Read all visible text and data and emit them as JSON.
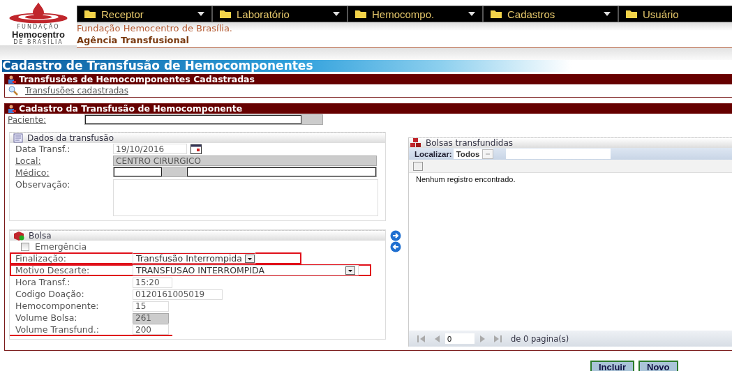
{
  "logo": {
    "top": "FUNDAÇÃO",
    "name": "Hemocentro",
    "bottom": "DE BRASÍLIA"
  },
  "nav": [
    {
      "label": "Receptor"
    },
    {
      "label": "Laboratório"
    },
    {
      "label": "Hemocompo."
    },
    {
      "label": "Cadastros"
    },
    {
      "label": "Usuário"
    }
  ],
  "header": {
    "organization": "Fundação Hemocentro de Brasília.",
    "unit": "Agência Transfusional"
  },
  "page_title": "Cadastro de Transfusão de Hemocomponentes",
  "list_section": {
    "title": "Transfusões de Hemocomponentes Cadastradas",
    "link": "Transfusões cadastradas"
  },
  "form_section": {
    "title": "Cadastro da Transfusão de Hemocomponente",
    "patient_label": "Paciente:"
  },
  "dados": {
    "title": "Dados da transfusão",
    "rows": [
      {
        "kind": "date",
        "label": "Data Transf.:",
        "link": false,
        "value": "19/10/2016"
      },
      {
        "kind": "readonly",
        "label": "Local:",
        "link": true,
        "value": "CENTRO CIRURGICO"
      },
      {
        "kind": "lookup",
        "label": "Médico:",
        "link": true
      },
      {
        "kind": "textarea",
        "label": "Observação:",
        "link": false
      }
    ]
  },
  "bolsa": {
    "title": "Bolsa",
    "rows": [
      {
        "kind": "checkbox",
        "label": "Emergência",
        "checked": false,
        "boxed": false,
        "underlined": false
      },
      {
        "kind": "select",
        "label": "Finalização:",
        "value": "Transfusão Interrompida",
        "boxed": true,
        "underlined": false
      },
      {
        "kind": "wideselect",
        "label": "Motivo Descarte:",
        "value": "TRANSFUSAO INTERROMPIDA",
        "boxed": true,
        "underlined": false
      },
      {
        "kind": "input",
        "label": "Hora Transf.:",
        "value": "15:20",
        "readonly": false,
        "boxed": false,
        "underlined": false
      },
      {
        "kind": "input",
        "label": "Codigo Doação:",
        "value": "0120161005019",
        "readonly": false,
        "boxed": false,
        "underlined": false
      },
      {
        "kind": "input",
        "label": "Hemocomponente:",
        "value": "15",
        "readonly": false,
        "boxed": false,
        "underlined": false
      },
      {
        "kind": "input",
        "label": "Volume Bolsa:",
        "value": "261",
        "readonly": true,
        "boxed": false,
        "underlined": false
      },
      {
        "kind": "input",
        "label": "Volume Transfund.:",
        "value": "200",
        "readonly": false,
        "boxed": false,
        "underlined": true
      }
    ]
  },
  "bolsas_panel": {
    "title": "Bolsas transfundidas",
    "search_label": "Localizar:",
    "filter": "Todos",
    "select_all_checked": false,
    "empty_message": "Nenhum registro encontrado.",
    "page": "0",
    "page_count": "de 0 pagina(s)"
  },
  "buttons": [
    {
      "label": "Incluir"
    },
    {
      "label": "Novo"
    }
  ]
}
